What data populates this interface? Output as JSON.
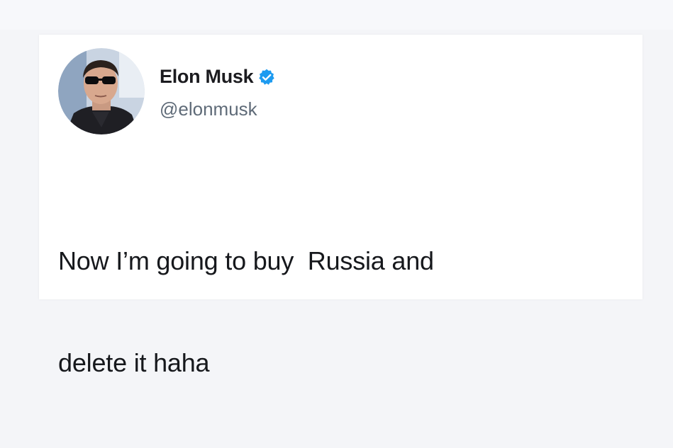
{
  "tweet": {
    "author": {
      "display_name": "Elon Musk",
      "handle": "@elonmusk",
      "verified": true
    },
    "text_line1": "Now I’m going to buy  Russia and",
    "text_line2": "delete it haha"
  },
  "icons": {
    "verified": "verified-badge-icon",
    "avatar": "profile-photo"
  },
  "colors": {
    "verified_blue": "#1d9bf0",
    "text": "#16181c",
    "handle": "#5f6b78"
  }
}
